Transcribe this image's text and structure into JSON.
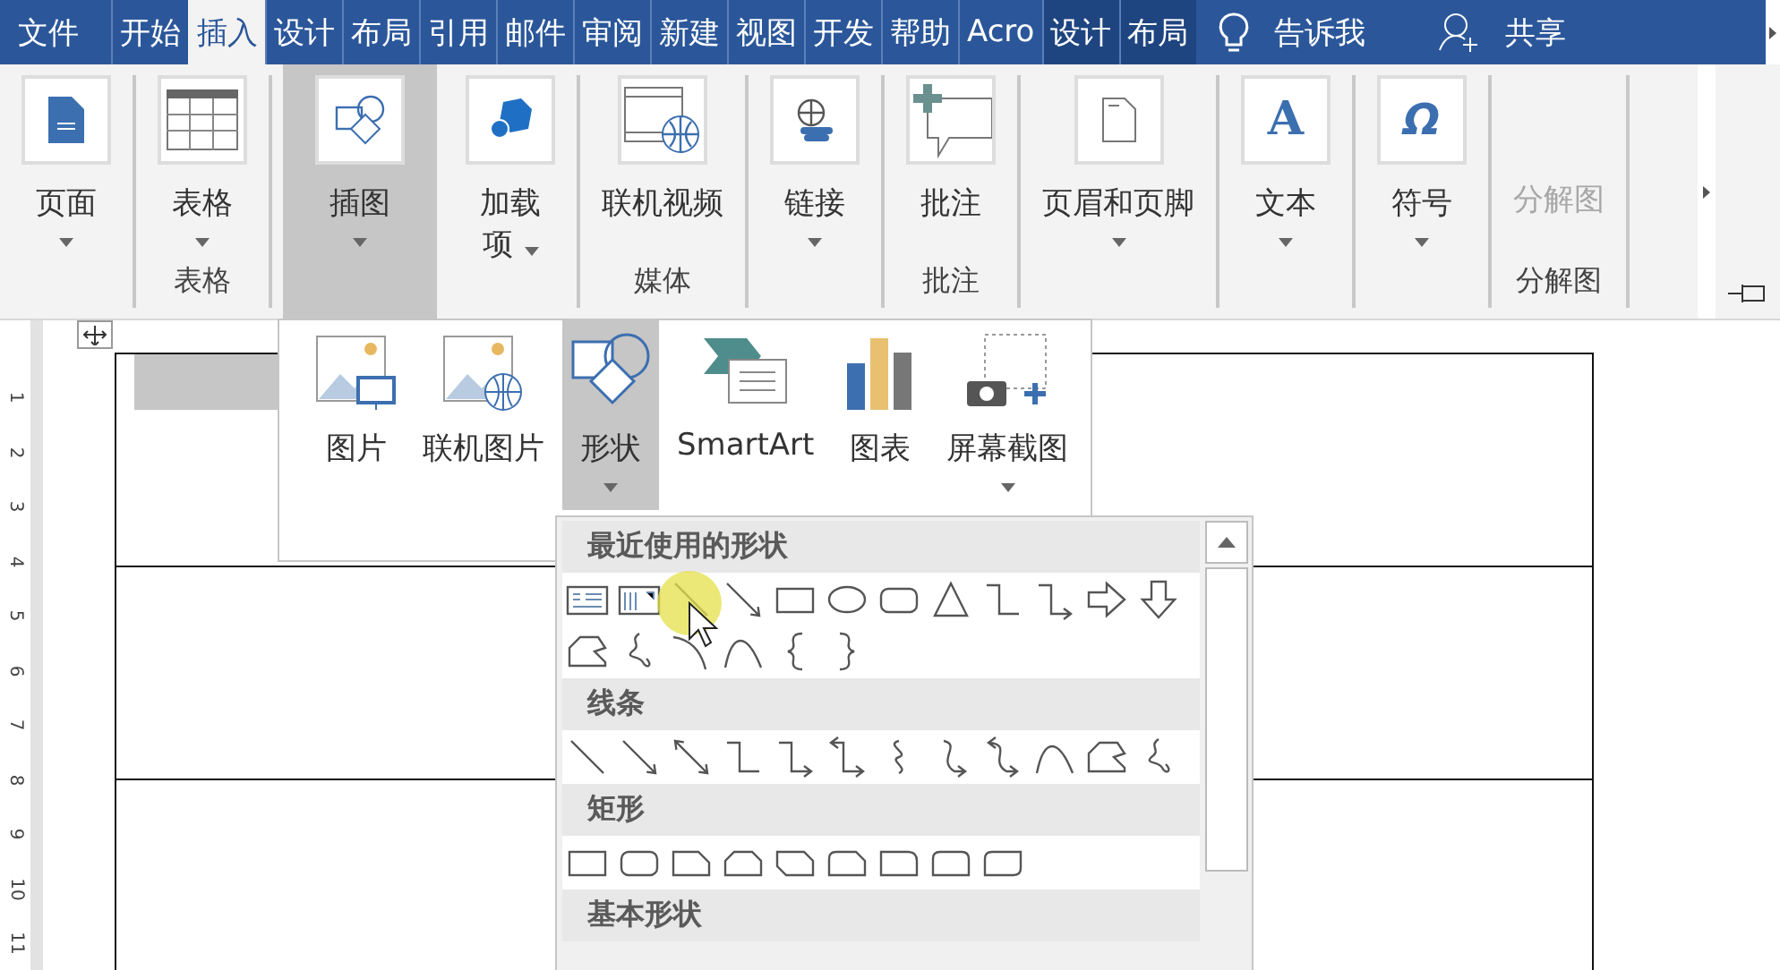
{
  "tabs": [
    {
      "label": "文件",
      "selected": false,
      "contextual": false
    },
    {
      "label": "开始",
      "selected": false,
      "contextual": false
    },
    {
      "label": "插入",
      "selected": true,
      "contextual": false
    },
    {
      "label": "设计",
      "selected": false,
      "contextual": false
    },
    {
      "label": "布局",
      "selected": false,
      "contextual": false
    },
    {
      "label": "引用",
      "selected": false,
      "contextual": false
    },
    {
      "label": "邮件",
      "selected": false,
      "contextual": false
    },
    {
      "label": "审阅",
      "selected": false,
      "contextual": false
    },
    {
      "label": "新建",
      "selected": false,
      "contextual": false
    },
    {
      "label": "视图",
      "selected": false,
      "contextual": false
    },
    {
      "label": "开发",
      "selected": false,
      "contextual": false
    },
    {
      "label": "帮助",
      "selected": false,
      "contextual": false
    },
    {
      "label": "Acro",
      "selected": false,
      "contextual": false
    },
    {
      "label": "设计",
      "selected": false,
      "contextual": true
    },
    {
      "label": "布局",
      "selected": false,
      "contextual": true
    }
  ],
  "tell_me": "告诉我",
  "share": "共享",
  "ribbon_groups": [
    {
      "buttons": [
        {
          "label": "页面",
          "caret": true,
          "pressed": false,
          "disabled": false
        }
      ]
    },
    {
      "label": "表格",
      "buttons": [
        {
          "label": "表格",
          "caret": true,
          "pressed": false,
          "disabled": false
        }
      ]
    },
    {
      "buttons": [
        {
          "label": "插图",
          "caret": true,
          "pressed": true,
          "disabled": false
        },
        {
          "lines": [
            "加载",
            "项"
          ],
          "caret": true,
          "pressed": false,
          "disabled": false
        }
      ]
    },
    {
      "label": "媒体",
      "buttons": [
        {
          "label": "联机视频",
          "caret": false,
          "pressed": false,
          "disabled": false
        }
      ]
    },
    {
      "buttons": [
        {
          "label": "链接",
          "caret": true,
          "pressed": false,
          "disabled": false
        }
      ]
    },
    {
      "label": "批注",
      "buttons": [
        {
          "label": "批注",
          "caret": false,
          "pressed": false,
          "disabled": false
        }
      ]
    },
    {
      "buttons": [
        {
          "label": "页眉和页脚",
          "caret": true,
          "pressed": false,
          "disabled": false
        }
      ]
    },
    {
      "buttons": [
        {
          "label": "文本",
          "glyph": "A",
          "caret": true,
          "pressed": false,
          "disabled": false
        }
      ]
    },
    {
      "buttons": [
        {
          "label": "符号",
          "glyph": "Ω",
          "caret": true,
          "pressed": false,
          "disabled": false
        }
      ]
    },
    {
      "label": "分解图",
      "buttons": [
        {
          "label": "分解图",
          "caret": false,
          "pressed": false,
          "disabled": true
        }
      ]
    }
  ],
  "ruler_marks": [
    "1",
    "2",
    "3",
    "4",
    "5",
    "6",
    "7",
    "8",
    "9",
    "10",
    "11"
  ],
  "illustrations_menu": [
    {
      "label": "图片",
      "caret": false,
      "pressed": false
    },
    {
      "label": "联机图片",
      "caret": false,
      "pressed": false
    },
    {
      "label": "形状",
      "caret": true,
      "pressed": true
    },
    {
      "label": "SmartArt",
      "caret": false,
      "pressed": false
    },
    {
      "label": "图表",
      "caret": false,
      "pressed": false
    },
    {
      "label": "屏幕截图",
      "caret": true,
      "pressed": false
    }
  ],
  "shape_sections": [
    {
      "title": "最近使用的形状"
    },
    {
      "title": "线条"
    },
    {
      "title": "矩形"
    },
    {
      "title": "基本形状"
    }
  ]
}
